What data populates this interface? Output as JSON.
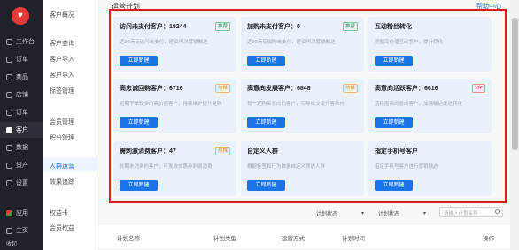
{
  "sidebar": {
    "logo_text": "♥",
    "items": [
      {
        "label": "工作台"
      },
      {
        "label": "订单"
      },
      {
        "label": "商品"
      },
      {
        "label": "店铺"
      },
      {
        "label": "订单"
      },
      {
        "label": "客户"
      },
      {
        "label": "数据"
      },
      {
        "label": "资产"
      },
      {
        "label": "设置"
      },
      {
        "label": "应用"
      },
      {
        "label": "主页"
      }
    ],
    "bottom_label": "收起"
  },
  "submenu": {
    "items": [
      {
        "label": "客户概况"
      },
      {
        "label": "客户查询"
      },
      {
        "label": "客户导入"
      },
      {
        "label": "客户导入"
      },
      {
        "label": "标签管理"
      },
      {
        "label": "会员管理"
      },
      {
        "label": "积分管理"
      },
      {
        "label": "人群运营"
      },
      {
        "label": "效果追踪"
      },
      {
        "label": "权益卡"
      },
      {
        "label": "会员权益"
      }
    ]
  },
  "header": {
    "title": "运营计划",
    "help": "帮助中心"
  },
  "cards": [
    {
      "title": "访问未支付客户：18244",
      "badge": "推荐",
      "badge_type": "green",
      "desc": "近30天有访问未支付，建议再次营销触达",
      "button": "立即新建"
    },
    {
      "title": "加购未支付客户：0",
      "badge": "推荐",
      "badge_type": "green",
      "desc": "近30天有加购未支付，建议再次营销触达",
      "button": "立即新建"
    },
    {
      "title": "互动粉丝转化",
      "badge": "",
      "badge_type": "",
      "desc": "挖掘高价值互动客户，提升转化",
      "button": "立即新建"
    },
    {
      "title": "高忠诚回购客户：6716",
      "badge": "热推",
      "badge_type": "orange",
      "desc": "近期下单较多的高价值客户，持续维护提升复购",
      "button": "立即新建"
    },
    {
      "title": "高意向发展客户：6848",
      "badge": "热推",
      "badge_type": "orange",
      "desc": "有一定购买意向的客户，引导成交提升客单价",
      "button": "立即新建"
    },
    {
      "title": "高意向活跃客户：6616",
      "badge": "VIP",
      "badge_type": "red",
      "desc": "活跃度高的意向客户，加强触达促进转化",
      "button": "立即新建"
    },
    {
      "title": "需刺激消费客户：47",
      "badge": "热推",
      "badge_type": "orange",
      "desc": "长期未消费的客户，可发放优惠券刺激消费",
      "button": "立即新建"
    },
    {
      "title": "自定义人群",
      "badge": "",
      "badge_type": "",
      "desc": "根据标签和行为数据自定义筛选人群",
      "button": "立即新建"
    },
    {
      "title": "指定手机号客户",
      "badge": "",
      "badge_type": "",
      "desc": "指定手机号客户进行营销触达",
      "button": "立即新建"
    }
  ],
  "filters": {
    "select1": "计划状态",
    "select2": "计划状态",
    "search_placeholder": "请输入计划名称"
  },
  "table": {
    "headers": [
      "计划名称",
      "计划类型",
      "运营方式",
      "计划时间",
      "操作"
    ]
  }
}
